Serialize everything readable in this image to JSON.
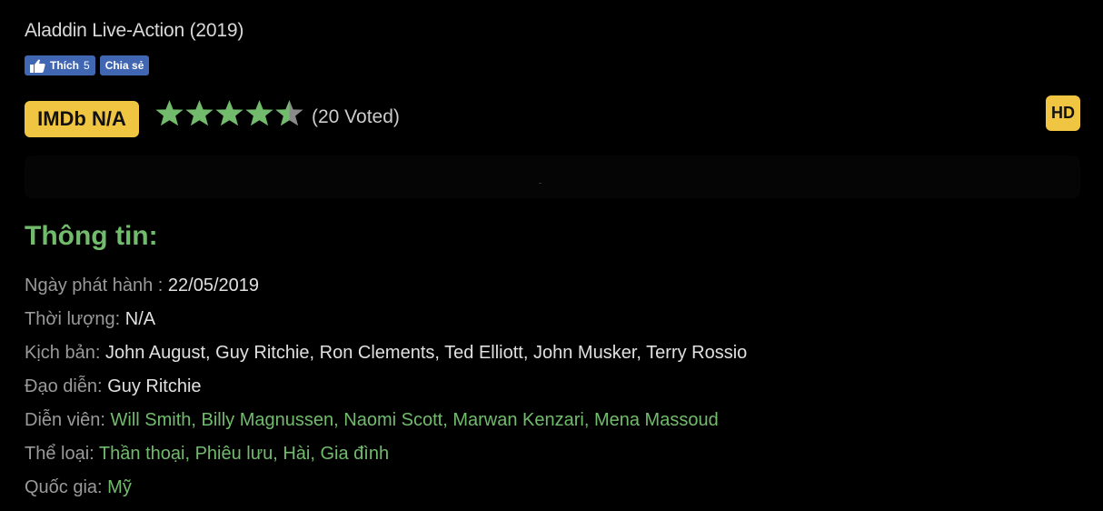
{
  "title": "Aladdin Live-Action (2019)",
  "social": {
    "like_label": "Thích",
    "like_count": "5",
    "share_label": "Chia sẻ"
  },
  "imdb": "IMDb N/A",
  "rating": {
    "stars": 4.5,
    "max": 5,
    "voted_text": "(20 Voted)",
    "color": "#72bb6d"
  },
  "quality_badge": "HD",
  "section_title": "Thông tin:",
  "info": {
    "release": {
      "label": "Ngày phát hành :",
      "value": "22/05/2019"
    },
    "duration": {
      "label": "Thời lượng:",
      "value": "N/A"
    },
    "writers": {
      "label": "Kịch bản:",
      "values": [
        "John August",
        "Guy Ritchie",
        "Ron Clements",
        "Ted Elliott",
        "John Musker",
        "Terry Rossio"
      ]
    },
    "director": {
      "label": "Đạo diễn:",
      "value": "Guy Ritchie"
    },
    "cast": {
      "label": "Diễn viên:",
      "values": [
        "Will Smith",
        "Billy Magnussen",
        "Naomi Scott",
        "Marwan Kenzari",
        "Mena Massoud"
      ]
    },
    "genres": {
      "label": "Thể loại:",
      "values": [
        "Thần thoại",
        "Phiêu lưu",
        "Hài",
        "Gia đình"
      ]
    },
    "country": {
      "label": "Quốc gia:",
      "value": "Mỹ"
    }
  },
  "colors": {
    "accent": "#72bb6d",
    "badge": "#f0c541",
    "facebook": "#4267b2"
  }
}
